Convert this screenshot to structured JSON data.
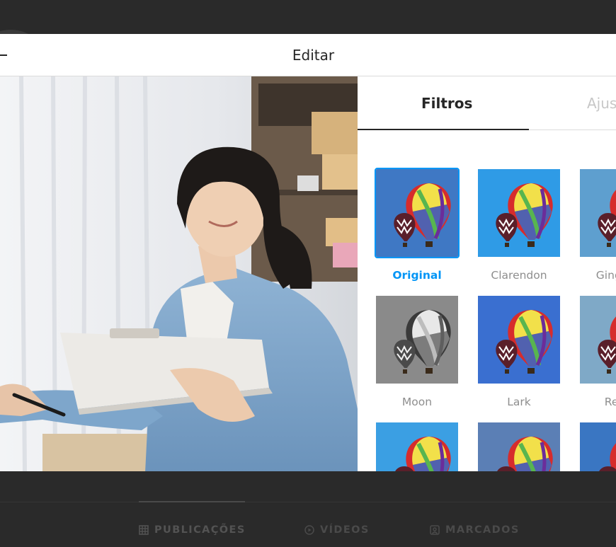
{
  "modal": {
    "title": "Editar"
  },
  "tabs": {
    "filters": "Filtros",
    "adjustments": "Ajustes"
  },
  "filters": [
    {
      "label": "Original",
      "selected": true,
      "bg": "#3f78c4"
    },
    {
      "label": "Clarendon",
      "selected": false,
      "bg": "#2f9be6"
    },
    {
      "label": "Gingham",
      "selected": false,
      "bg": "#5e9fcf"
    },
    {
      "label": "Moon",
      "selected": false,
      "bg": "#8a8a8a"
    },
    {
      "label": "Lark",
      "selected": false,
      "bg": "#3a6fd0"
    },
    {
      "label": "Reyes",
      "selected": false,
      "bg": "#7fa9c7"
    },
    {
      "label": "",
      "selected": false,
      "bg": "#3b9fe3"
    },
    {
      "label": "",
      "selected": false,
      "bg": "#5b7fb5"
    },
    {
      "label": "",
      "selected": false,
      "bg": "#3a76c2"
    }
  ],
  "profile_tabs": [
    {
      "label": "PUBLICAÇÕES",
      "icon": "grid-icon"
    },
    {
      "label": "VÍDEOS",
      "icon": "play-icon"
    },
    {
      "label": "MARCADOS",
      "icon": "tag-icon"
    }
  ],
  "colors": {
    "accent": "#0095f6",
    "text": "#262626",
    "muted": "#8e8e8e"
  }
}
